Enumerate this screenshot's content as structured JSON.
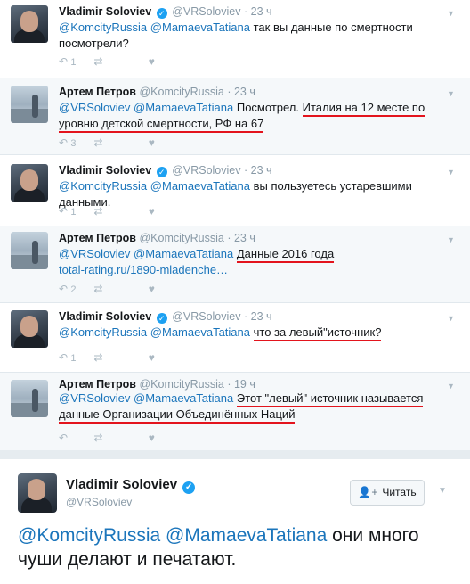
{
  "tweets": [
    {
      "name": "Vladimir Soloviev",
      "verified": true,
      "handle": "@VRSoloviev",
      "time": "23 ч",
      "mention1": "@KomcityRussia",
      "mention2": "@MamaevaTatiana",
      "text": "так вы данные по смертности посмотрели?",
      "reply_count": "1",
      "avatar": "vladimir-avatar"
    },
    {
      "name": "Артем Петров",
      "verified": false,
      "handle": "@KomcityRussia",
      "time": "23 ч",
      "mention1": "@VRSoloviev",
      "mention2": "@MamaevaTatiana",
      "text_plain": "Посмотрел.",
      "text_underlined": "Италия на 12 месте по уровню детской смертности, РФ на 67",
      "reply_count": "3",
      "avatar": "artem-avatar"
    },
    {
      "name": "Vladimir Soloviev",
      "verified": true,
      "handle": "@VRSoloviev",
      "time": "23 ч",
      "mention1": "@KomcityRussia",
      "mention2": "@MamaevaTatiana",
      "text": "вы пользуетесь устаревшими данными.",
      "reply_count": "1",
      "avatar": "vladimir-avatar"
    },
    {
      "name": "Артем Петров",
      "verified": false,
      "handle": "@KomcityRussia",
      "time": "23 ч",
      "mention1": "@VRSoloviev",
      "mention2": "@MamaevaTatiana",
      "text_underlined": "Данные 2016 года",
      "link": "total-rating.ru/1890-mladenche…",
      "reply_count": "2",
      "avatar": "artem-avatar"
    },
    {
      "name": "Vladimir Soloviev",
      "verified": true,
      "handle": "@VRSoloviev",
      "time": "23 ч",
      "mention1": "@KomcityRussia",
      "mention2": "@MamaevaTatiana",
      "text_underlined": "что за левый\"источник?",
      "reply_count": "1",
      "avatar": "vladimir-avatar"
    },
    {
      "name": "Артем Петров",
      "verified": false,
      "handle": "@KomcityRussia",
      "time": "19 ч",
      "mention1": "@VRSoloviev",
      "mention2": "@MamaevaTatiana",
      "text_underlined": "Этот \"левый\" источник называется данные Организации Объединённых Наций",
      "reply_count": "",
      "avatar": "artem-avatar"
    }
  ],
  "main_tweet": {
    "name": "Vladimir Soloviev",
    "verified": true,
    "handle": "@VRSoloviev",
    "follow_label": "Читать",
    "mention1": "@KomcityRussia",
    "mention2": "@MamaevaTatiana",
    "text": "они много чуши делают и печатают."
  },
  "colors": {
    "mention": "#1b75bb",
    "underline": "#e3141d",
    "verified": "#1da1f2",
    "meta": "#8899a6"
  }
}
